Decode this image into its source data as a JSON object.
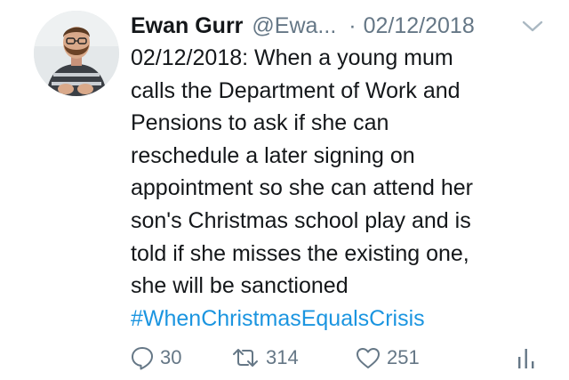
{
  "tweet": {
    "author_name": "Ewan Gurr",
    "handle": "@Ewa...",
    "separator": "·",
    "timestamp": "02/12/2018",
    "lines": [
      "02/12/2018: When a young mum",
      "calls the Department of Work and",
      "Pensions to ask if she can",
      "reschedule a later signing on",
      "appointment so she can attend her",
      "son's Christmas school play and is",
      "told if she misses the existing one,",
      "she will be sanctioned"
    ],
    "hashtag": "#WhenChristmasEqualsCrisis"
  },
  "actions": {
    "reply_count": "30",
    "retweet_count": "314",
    "like_count": "251"
  },
  "icons": {
    "reply": "reply-icon",
    "retweet": "retweet-icon",
    "like": "heart-icon",
    "analytics": "analytics-icon",
    "menu": "chevron-down-icon"
  },
  "colors": {
    "text": "#14171a",
    "secondary": "#657786",
    "link": "#1b95e0",
    "background": "#ffffff"
  }
}
